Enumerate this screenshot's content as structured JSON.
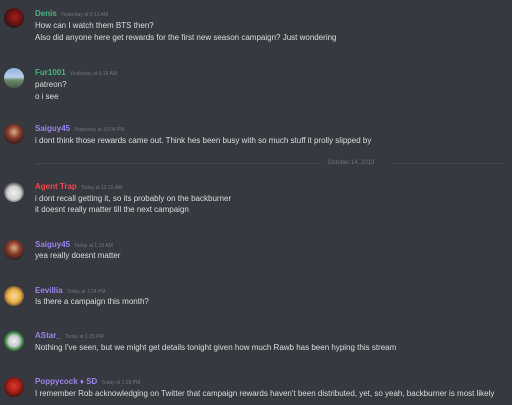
{
  "colors": {
    "background": "#36393f",
    "text": "#dcddde",
    "timestamp": "#72767d"
  },
  "messages": [
    {
      "author": "Denis",
      "author_color": "#43b581",
      "timestamp": "Yesterday at 6:13 AM",
      "avatar_icon": "dark-red-avatar-icon",
      "lines": [
        "How can I watch them BTS then?",
        "Also did anyone here get rewards for the first new season campaign? Just wondering"
      ]
    },
    {
      "author": "Fur1001",
      "author_color": "#43b581",
      "timestamp": "Yesterday at 6:16 AM",
      "avatar_icon": "landscape-avatar-icon",
      "lines": [
        "patreon?",
        "o i see"
      ]
    },
    {
      "author": "Saiguy45",
      "author_color": "#9b84ec",
      "timestamp": "Yesterday at 10:04 PM",
      "avatar_icon": "character-avatar-icon",
      "lines": [
        "i dont think those rewards came out.  Think hes been busy with so much stuff it prolly slipped by"
      ]
    },
    {
      "author": "Agent Trap",
      "author_color": "#f04747",
      "timestamp": "Today at 12:15 AM",
      "avatar_icon": "white-creature-avatar-icon",
      "lines": [
        "i dont recall getting it, so its probably on the backburner",
        "it doesnt really matter till the next campaign"
      ]
    },
    {
      "author": "Saiguy45",
      "author_color": "#9b84ec",
      "timestamp": "Today at 1:15 AM",
      "avatar_icon": "character-avatar-icon",
      "lines": [
        "yea really doesnt matter"
      ]
    },
    {
      "author": "Eevillia",
      "author_color": "#9b84ec",
      "timestamp": "Today at 1:24 PM",
      "avatar_icon": "blonde-character-avatar-icon",
      "lines": [
        "Is there a campaign this month?"
      ]
    },
    {
      "author": "AStar_",
      "author_color": "#9b84ec",
      "timestamp": "Today at 1:25 PM",
      "avatar_icon": "clown-avatar-icon",
      "lines": [
        "Nothing I've seen, but we might get details tonight given how much Rawb has been hyping this stream"
      ]
    },
    {
      "author": "Poppycock ♦ SD",
      "author_color": "#9b84ec",
      "timestamp": "Today at 1:28 PM",
      "avatar_icon": "red-creature-avatar-icon",
      "lines": [
        "I remember Rob acknowledging on Twitter that campaign rewards haven't been distributed, yet, so yeah, backburner is most likely"
      ]
    }
  ],
  "date_divider": "October 14, 2019"
}
